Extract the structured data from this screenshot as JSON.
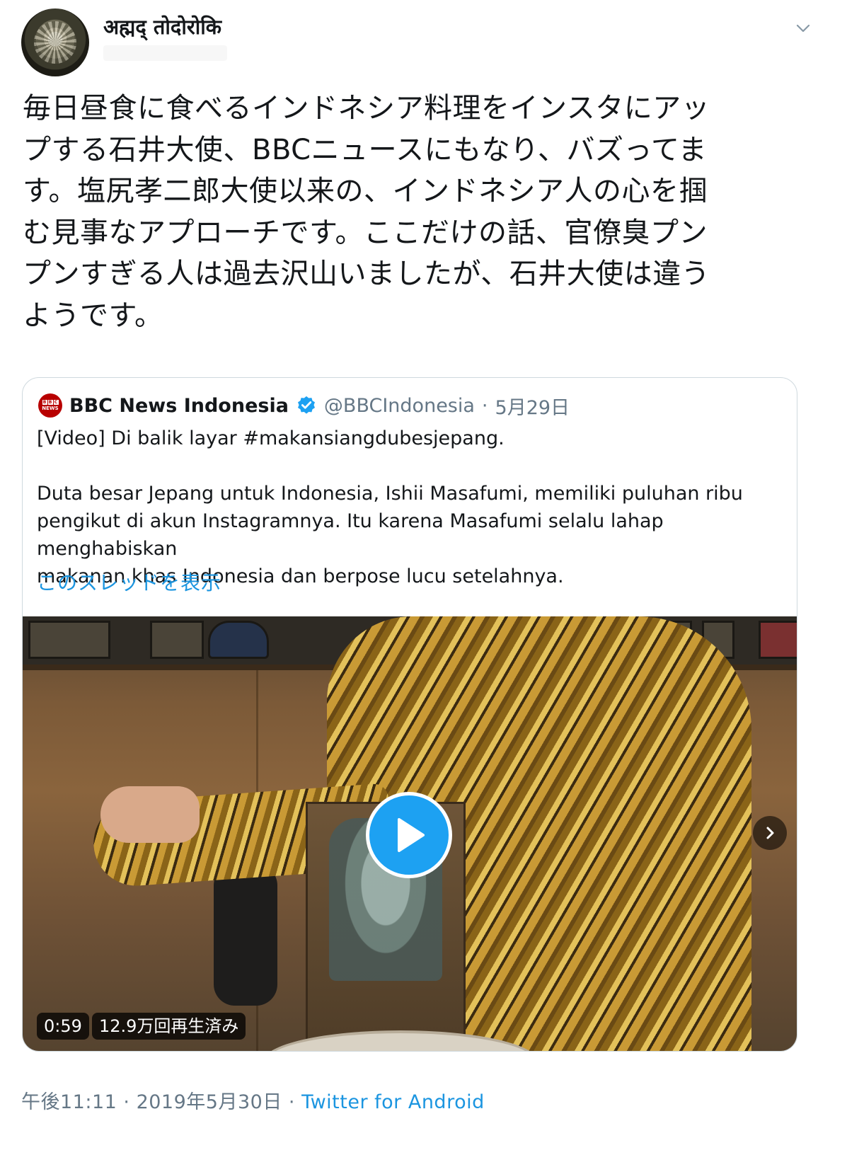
{
  "author": {
    "display_name": "अह्मद् तोदोरोकि",
    "avatar_icon": "avatar-image"
  },
  "tweet": {
    "text": "毎日昼食に食べるインドネシア料理をインスタにアッ\nプする石井大使、BBCニュースにもなり、バズってま\nす。塩尻孝二郎大使以来の、インドネシア人の心を掴\nむ見事なアプローチです。ここだけの話、官僚臭プン\nプンすぎる人は過去沢山いましたが、石井大使は違う\nようです。"
  },
  "quote": {
    "name": "BBC News Indonesia",
    "handle": "@BBCIndonesia",
    "separator": " · ",
    "date": "5月29日",
    "text": "[Video] Di balik layar #makansiangdubesjepang.\n\nDuta besar Jepang untuk Indonesia, Ishii Masafumi, memiliki puluhan ribu\npengikut di akun Instagramnya. Itu karena Masafumi selalu lahap menghabiskan\nmakanan khas Indonesia dan berpose lucu setelahnya.",
    "show_thread": "このスレッドを表示",
    "video": {
      "duration": "0:59",
      "views": "12.9万回再生済み"
    }
  },
  "footer": {
    "time": "午後11:11",
    "sep1": " · ",
    "date": "2019年5月30日",
    "sep2": " · ",
    "source": "Twitter for Android"
  },
  "colors": {
    "link": "#1b95e0",
    "play_button": "#1da1f2",
    "bbc_red": "#b80000",
    "muted": "#657786"
  }
}
